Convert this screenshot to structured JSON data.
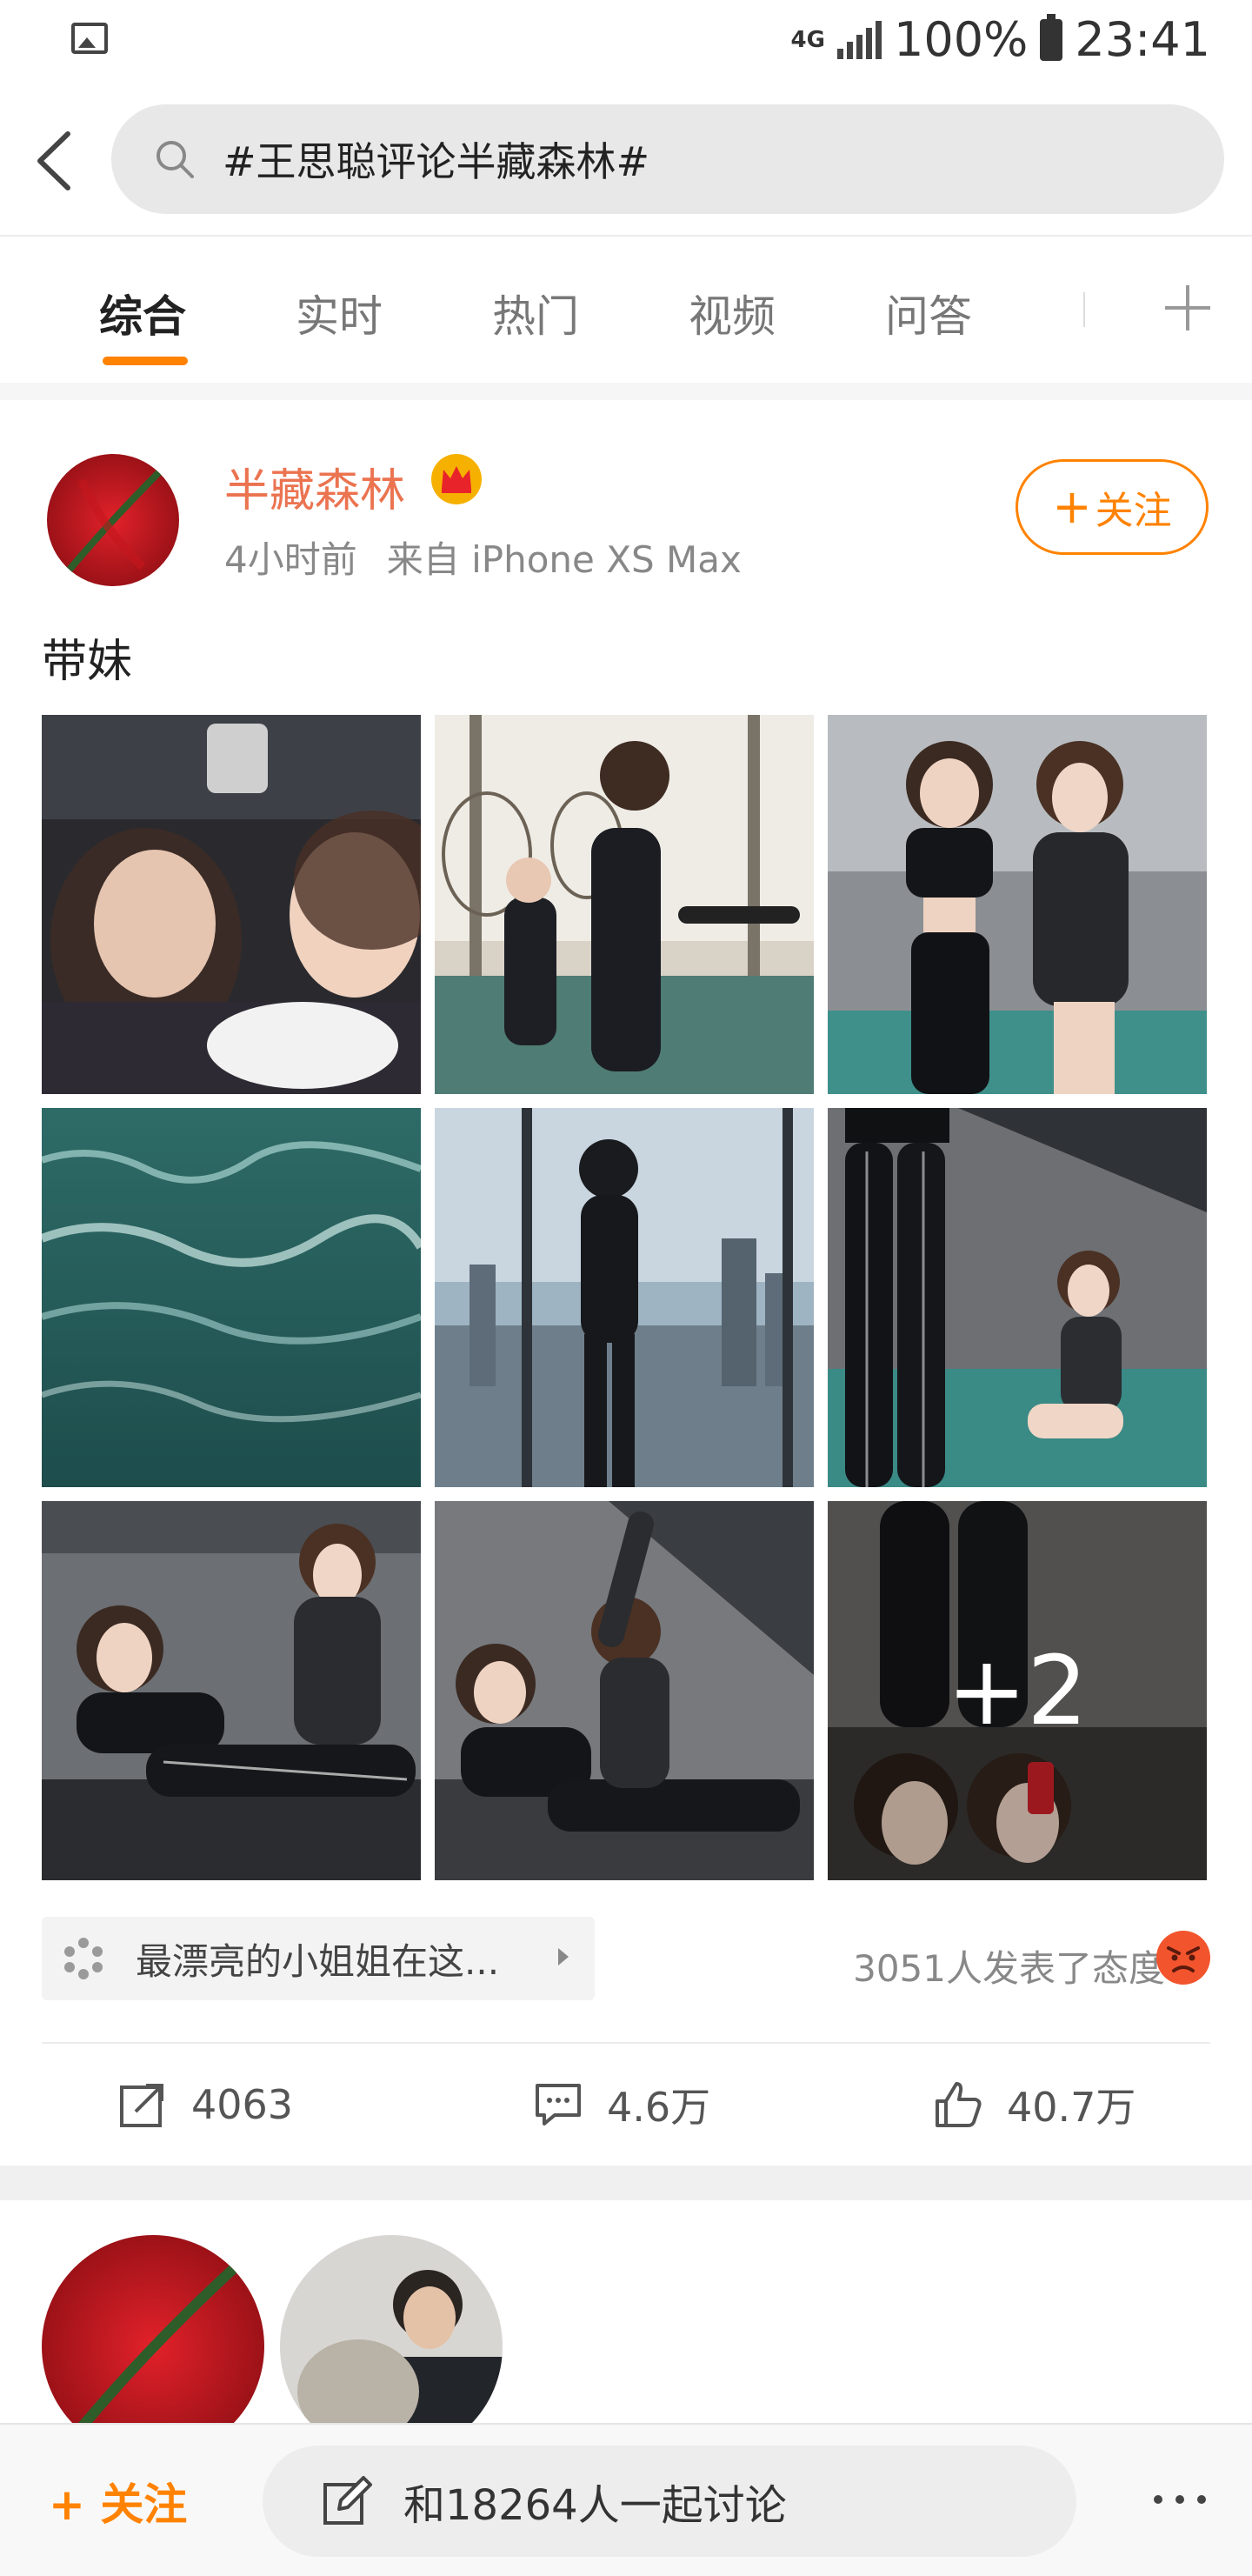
{
  "status_bar": {
    "network": "4G",
    "battery": "100%",
    "time": "23:41"
  },
  "search": {
    "query": "#王思聪评论半藏森林#"
  },
  "tabs": [
    {
      "label": "综合",
      "active": true
    },
    {
      "label": "实时",
      "active": false
    },
    {
      "label": "热门",
      "active": false
    },
    {
      "label": "视频",
      "active": false
    },
    {
      "label": "问答",
      "active": false
    }
  ],
  "post": {
    "user_name": "半藏森林",
    "time_ago": "4小时前",
    "source": "来自 iPhone XS Max",
    "follow_label": "关注",
    "text": "带妹",
    "images": [
      {
        "desc": "car-selfie"
      },
      {
        "desc": "pool-duo-standing"
      },
      {
        "desc": "duo-swimsuits"
      },
      {
        "desc": "water-surface"
      },
      {
        "desc": "city-window-silhouette"
      },
      {
        "desc": "legs-poolside"
      },
      {
        "desc": "duo-lounging"
      },
      {
        "desc": "duo-stretch"
      },
      {
        "desc": "legs-mirror-selfie"
      }
    ],
    "more_images": "+2",
    "topic_chip": "最漂亮的小姐姐在这...",
    "attitude_text": "3051人发表了态度",
    "repost_count": "4063",
    "comment_count": "4.6万",
    "like_count": "40.7万"
  },
  "bottom_bar": {
    "follow_label": "关注",
    "discuss_label": "和18264人一起讨论"
  },
  "colors": {
    "accent": "#ff8200",
    "username": "#eb7350"
  }
}
